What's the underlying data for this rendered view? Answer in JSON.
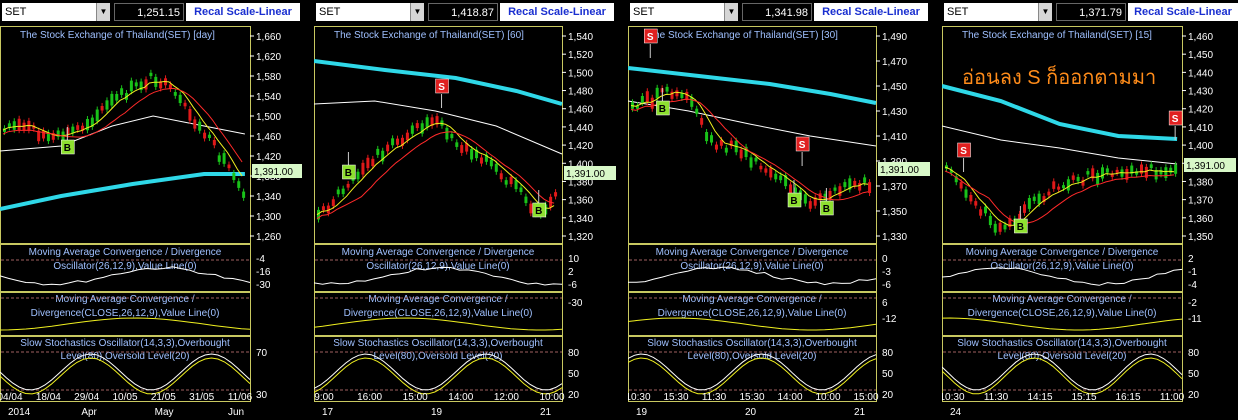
{
  "panels": [
    {
      "symbol": "SET",
      "price": "1,251.15",
      "recal_label": "Recal Scale-Linear",
      "title": "The Stock Exchange of Thailand(SET) [day]",
      "price_axis": [
        "1,660",
        "1,620",
        "1,580",
        "1,540",
        "1,500",
        "1,460",
        "1,420",
        "1,380",
        "1,340",
        "1,300",
        "1,260"
      ],
      "current_tag": "1,391.00",
      "macd_title": [
        "Moving Average Convergence / Divergence",
        "Oscillator(26,12,9),Value Line(0)"
      ],
      "macd_axis": [
        "-4",
        "-16",
        "-30"
      ],
      "macd2_title": [
        "Moving Average Convergence /",
        "Divergence(CLOSE,26,12,9),Value Line(0)"
      ],
      "stoch_title": [
        "Slow Stochastics Oscillator(14,3,3),Overbought",
        "Level(80),Oversold Level(20)"
      ],
      "stoch_axis": [
        "70",
        "30"
      ],
      "x_top": [
        "04/04",
        "18/04",
        "29/04",
        "10/05",
        "21/05",
        "31/05",
        "11/06"
      ],
      "x_bottom": [
        "2014",
        "Apr",
        "May",
        "Jun"
      ],
      "markers": [
        "B"
      ]
    },
    {
      "symbol": "SET",
      "price": "1,418.87",
      "recal_label": "Recal Scale-Linear",
      "title": "The Stock Exchange of Thailand(SET) [60]",
      "price_axis": [
        "1,540",
        "1,520",
        "1,500",
        "1,480",
        "1,460",
        "1,440",
        "1,420",
        "1,400",
        "1,380",
        "1,360",
        "1,340",
        "1,320"
      ],
      "current_tag": "1,391.00",
      "macd_title": [
        "Moving Average Convergence / Divergence",
        "Oscillator(26,12,9),Value Line(0)"
      ],
      "macd_axis": [
        "10",
        "2",
        "-6"
      ],
      "macd2_title": [
        "Moving Average Convergence /",
        "Divergence(CLOSE,26,12,9),Value Line(0)"
      ],
      "macd2_axis": [
        "-30"
      ],
      "stoch_title": [
        "Slow Stochastics Oscillator(14,3,3),Overbought",
        "Level(80),Oversold Level(20)"
      ],
      "stoch_axis": [
        "80",
        "50",
        "20"
      ],
      "x_top": [
        "9:00",
        "16:00",
        "15:00",
        "14:00",
        "12:00",
        "10:00"
      ],
      "x_bottom": [
        "17",
        "19",
        "21"
      ],
      "markers": [
        "S",
        "B",
        "B"
      ]
    },
    {
      "symbol": "SET",
      "price": "1,341.98",
      "recal_label": "Recal Scale-Linear",
      "title": "The Stock Exchange of Thailand(SET) [30]",
      "price_axis": [
        "1,490",
        "1,470",
        "1,450",
        "1,430",
        "1,410",
        "1,390",
        "1,370",
        "1,350",
        "1,330"
      ],
      "current_tag": "1,391.00",
      "macd_title": [
        "Moving Average Convergence / Divergence",
        "Oscillator(26,12,9),Value Line(0)"
      ],
      "macd_axis": [
        "0",
        "-3",
        "-6"
      ],
      "macd2_title": [
        "Moving Average Convergence /",
        "Divergence(CLOSE,26,12,9),Value Line(0)"
      ],
      "macd2_axis": [
        "6",
        "-12"
      ],
      "stoch_title": [
        "Slow Stochastics Oscillator(14,3,3),Overbought",
        "Level(80),Oversold Level(20)"
      ],
      "stoch_axis": [
        "80",
        "50",
        "20"
      ],
      "x_top": [
        "10:30",
        "15:30",
        "11:30",
        "15:30",
        "14:00",
        "10:00",
        "15:00"
      ],
      "x_bottom": [
        "19",
        "20",
        "21"
      ],
      "markers": [
        "S",
        "B",
        "S",
        "B",
        "B"
      ]
    },
    {
      "symbol": "SET",
      "price": "1,371.79",
      "recal_label": "Recal Scale-Linear",
      "title": "The Stock Exchange of Thailand(SET) [15]",
      "price_axis": [
        "1,460",
        "1,450",
        "1,440",
        "1,430",
        "1,420",
        "1,410",
        "1,400",
        "1,390",
        "1,380",
        "1,370",
        "1,360",
        "1,350"
      ],
      "current_tag": "1,391.00",
      "macd_title": [
        "Moving Average Convergence / Divergence",
        "Oscillator(26,12,9),Value Line(0)"
      ],
      "macd_axis": [
        "2",
        "-1",
        "-4"
      ],
      "macd2_title": [
        "Moving Average Convergence /",
        "Divergence(CLOSE,26,12,9),Value Line(0)"
      ],
      "macd2_axis": [
        "-2",
        "-11"
      ],
      "stoch_title": [
        "Slow Stochastics Oscillator(14,3,3),Overbought",
        "Level(80),Oversold Level(20)"
      ],
      "stoch_axis": [
        "80",
        "50",
        "20"
      ],
      "x_top": [
        "10:30",
        "11:30",
        "14:15",
        "15:15",
        "16:15",
        "11:00"
      ],
      "x_bottom": [
        "24"
      ],
      "markers": [
        "S",
        "B",
        "S"
      ],
      "annotation": "อ่อนลง S ก็ออกตามมา"
    }
  ],
  "colors": {
    "bull": "#19c219",
    "bear": "#e01919",
    "ma_long": "#2fd8e8",
    "ma_mid": "#ffffff",
    "ma_short": "#f0f020",
    "ma_red": "#ff2a2a",
    "grid": "#3a3a3a",
    "pane_border": "#c8c860",
    "title_text": "#9fc0ff",
    "annotation": "#ff8c1a"
  }
}
